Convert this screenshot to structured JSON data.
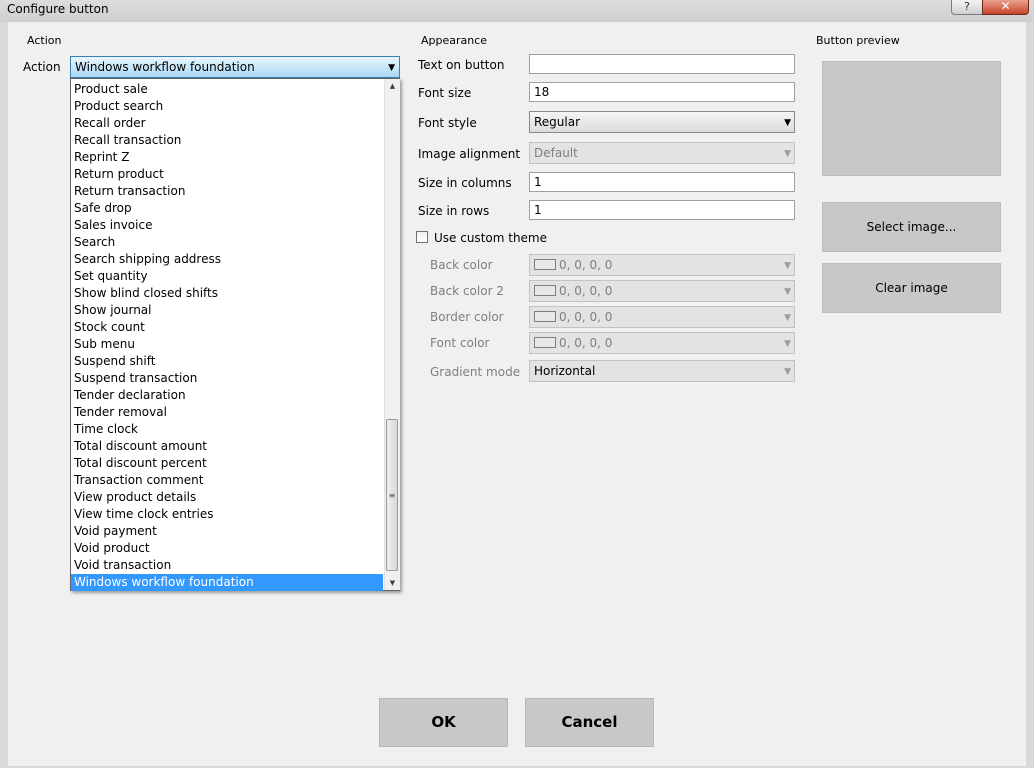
{
  "window": {
    "title": "Configure button",
    "help_glyph": "?",
    "close_glyph": "✕"
  },
  "action_section": {
    "header": "Action",
    "label": "Action",
    "selected": "Windows workflow foundation",
    "options": [
      "Product sale",
      "Product search",
      "Recall order",
      "Recall transaction",
      "Reprint Z",
      "Return product",
      "Return transaction",
      "Safe drop",
      "Sales invoice",
      "Search",
      "Search shipping address",
      "Set quantity",
      "Show blind closed shifts",
      "Show journal",
      "Stock count",
      "Sub menu",
      "Suspend shift",
      "Suspend transaction",
      "Tender declaration",
      "Tender removal",
      "Time clock",
      "Total discount amount",
      "Total discount percent",
      "Transaction comment",
      "View product details",
      "View time clock entries",
      "Void payment",
      "Void product",
      "Void transaction",
      "Windows workflow foundation"
    ]
  },
  "appearance": {
    "header": "Appearance",
    "text_on_button": {
      "label": "Text on button",
      "value": ""
    },
    "font_size": {
      "label": "Font size",
      "value": "18"
    },
    "font_style": {
      "label": "Font style",
      "value": "Regular"
    },
    "image_alignment": {
      "label": "Image alignment",
      "value": "Default"
    },
    "size_in_columns": {
      "label": "Size in columns",
      "value": "1"
    },
    "size_in_rows": {
      "label": "Size in rows",
      "value": "1"
    },
    "use_custom_theme": {
      "label": "Use custom theme",
      "checked": false
    },
    "back_color": {
      "label": "Back color",
      "value": "0, 0, 0, 0"
    },
    "back_color_2": {
      "label": "Back color 2",
      "value": "0, 0, 0, 0"
    },
    "border_color": {
      "label": "Border color",
      "value": "0, 0, 0, 0"
    },
    "font_color": {
      "label": "Font color",
      "value": "0, 0, 0, 0"
    },
    "gradient_mode": {
      "label": "Gradient mode",
      "value": "Horizontal"
    }
  },
  "preview": {
    "header": "Button preview",
    "select_image": "Select image...",
    "clear_image": "Clear image"
  },
  "footer": {
    "ok": "OK",
    "cancel": "Cancel"
  },
  "colors": {
    "selection": "#3399ff",
    "dialog_bg": "#f0f0f0",
    "button_gray": "#c8c8c8"
  }
}
